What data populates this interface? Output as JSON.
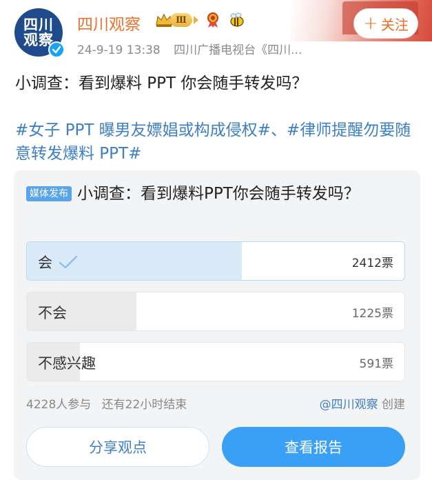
{
  "header": {
    "avatar_line1": "四川",
    "avatar_line2": "观察",
    "user_name": "四川观察",
    "level": "Ⅲ",
    "date": "24-9-19 13:38",
    "source": "四川广播电视台《四川...",
    "follow_label": "关注",
    "follow_plus": "+"
  },
  "post": {
    "text": "小调查：看到爆料 PPT 你会随手转发吗？",
    "hashtags": "#女子 PPT 曝男友嫖娼或构成侵权#、#律师提醒勿要随意转发爆料 PPT#"
  },
  "poll": {
    "tag": "媒体发布",
    "question": "小调查：看到爆料PPT你会随手转发吗？",
    "options": [
      {
        "label": "会",
        "count": "2412票",
        "fraction": 0.57,
        "selected": true
      },
      {
        "label": "不会",
        "count": "1225票",
        "fraction": 0.29,
        "selected": false
      },
      {
        "label": "不感兴趣",
        "count": "591票",
        "fraction": 0.14,
        "selected": false
      }
    ],
    "participants": "4228人参与",
    "time_left": "还有22小时结束",
    "creator_at": "@四川观察",
    "creator_suffix": "创建",
    "share_label": "分享观点",
    "report_label": "查看报告"
  },
  "colors": {
    "accent_orange": "#f06c20",
    "link_blue": "#3e7fc4",
    "button_blue": "#3aa0f5"
  }
}
